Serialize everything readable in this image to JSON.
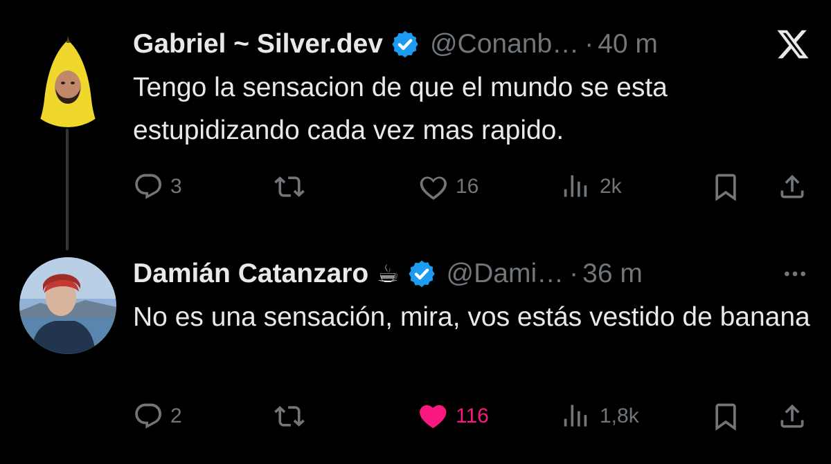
{
  "tweets": [
    {
      "name": "Gabriel ~ Silver.dev",
      "handle": "@Conanb…",
      "separator": "·",
      "time": "40 m",
      "text": "Tengo la sensacion de que el mundo se esta estupidizando cada vez mas rapido.",
      "replies": "3",
      "likes": "16",
      "views": "2k",
      "liked": false,
      "corner_icon": "x-logo-icon"
    },
    {
      "name": "Damián Catanzaro",
      "emoji": "☕",
      "handle": "@Dami…",
      "separator": "·",
      "time": "36 m",
      "text": "No es una sensación, mira, vos estás vestido de banana",
      "replies": "2",
      "likes": "116",
      "views": "1,8k",
      "liked": true,
      "corner_icon": "more-options-icon"
    }
  ],
  "colors": {
    "background": "#000000",
    "text": "#e7e9ea",
    "muted": "#71767b",
    "verified": "#1d9bf0",
    "like": "#f91880",
    "thread_line": "#333639"
  }
}
